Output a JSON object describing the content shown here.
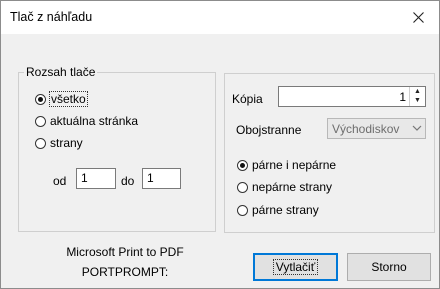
{
  "window": {
    "title": "Tlač z náhľadu",
    "close_icon": "close-icon"
  },
  "range": {
    "legend": "Rozsah tlače",
    "options": [
      "všetko",
      "aktuálna stránka",
      "strany"
    ],
    "selected": "všetko",
    "from_label": "od",
    "from_value": "1",
    "to_label": "do",
    "to_value": "1"
  },
  "copies": {
    "label": "Kópia",
    "value": "1"
  },
  "duplex": {
    "label": "Obojstranne",
    "value": "Východiskov"
  },
  "pages": {
    "options": [
      "párne i nepárne",
      "nepárne strany",
      "párne strany"
    ],
    "selected": "párne i nepárne"
  },
  "printer": {
    "name": "Microsoft Print to PDF",
    "port": "PORTPROMPT:"
  },
  "buttons": {
    "print": "Vytlačiť",
    "cancel": "Storno"
  },
  "colors": {
    "accent": "#0078d7",
    "dialog_bg": "#f0f0f0"
  }
}
